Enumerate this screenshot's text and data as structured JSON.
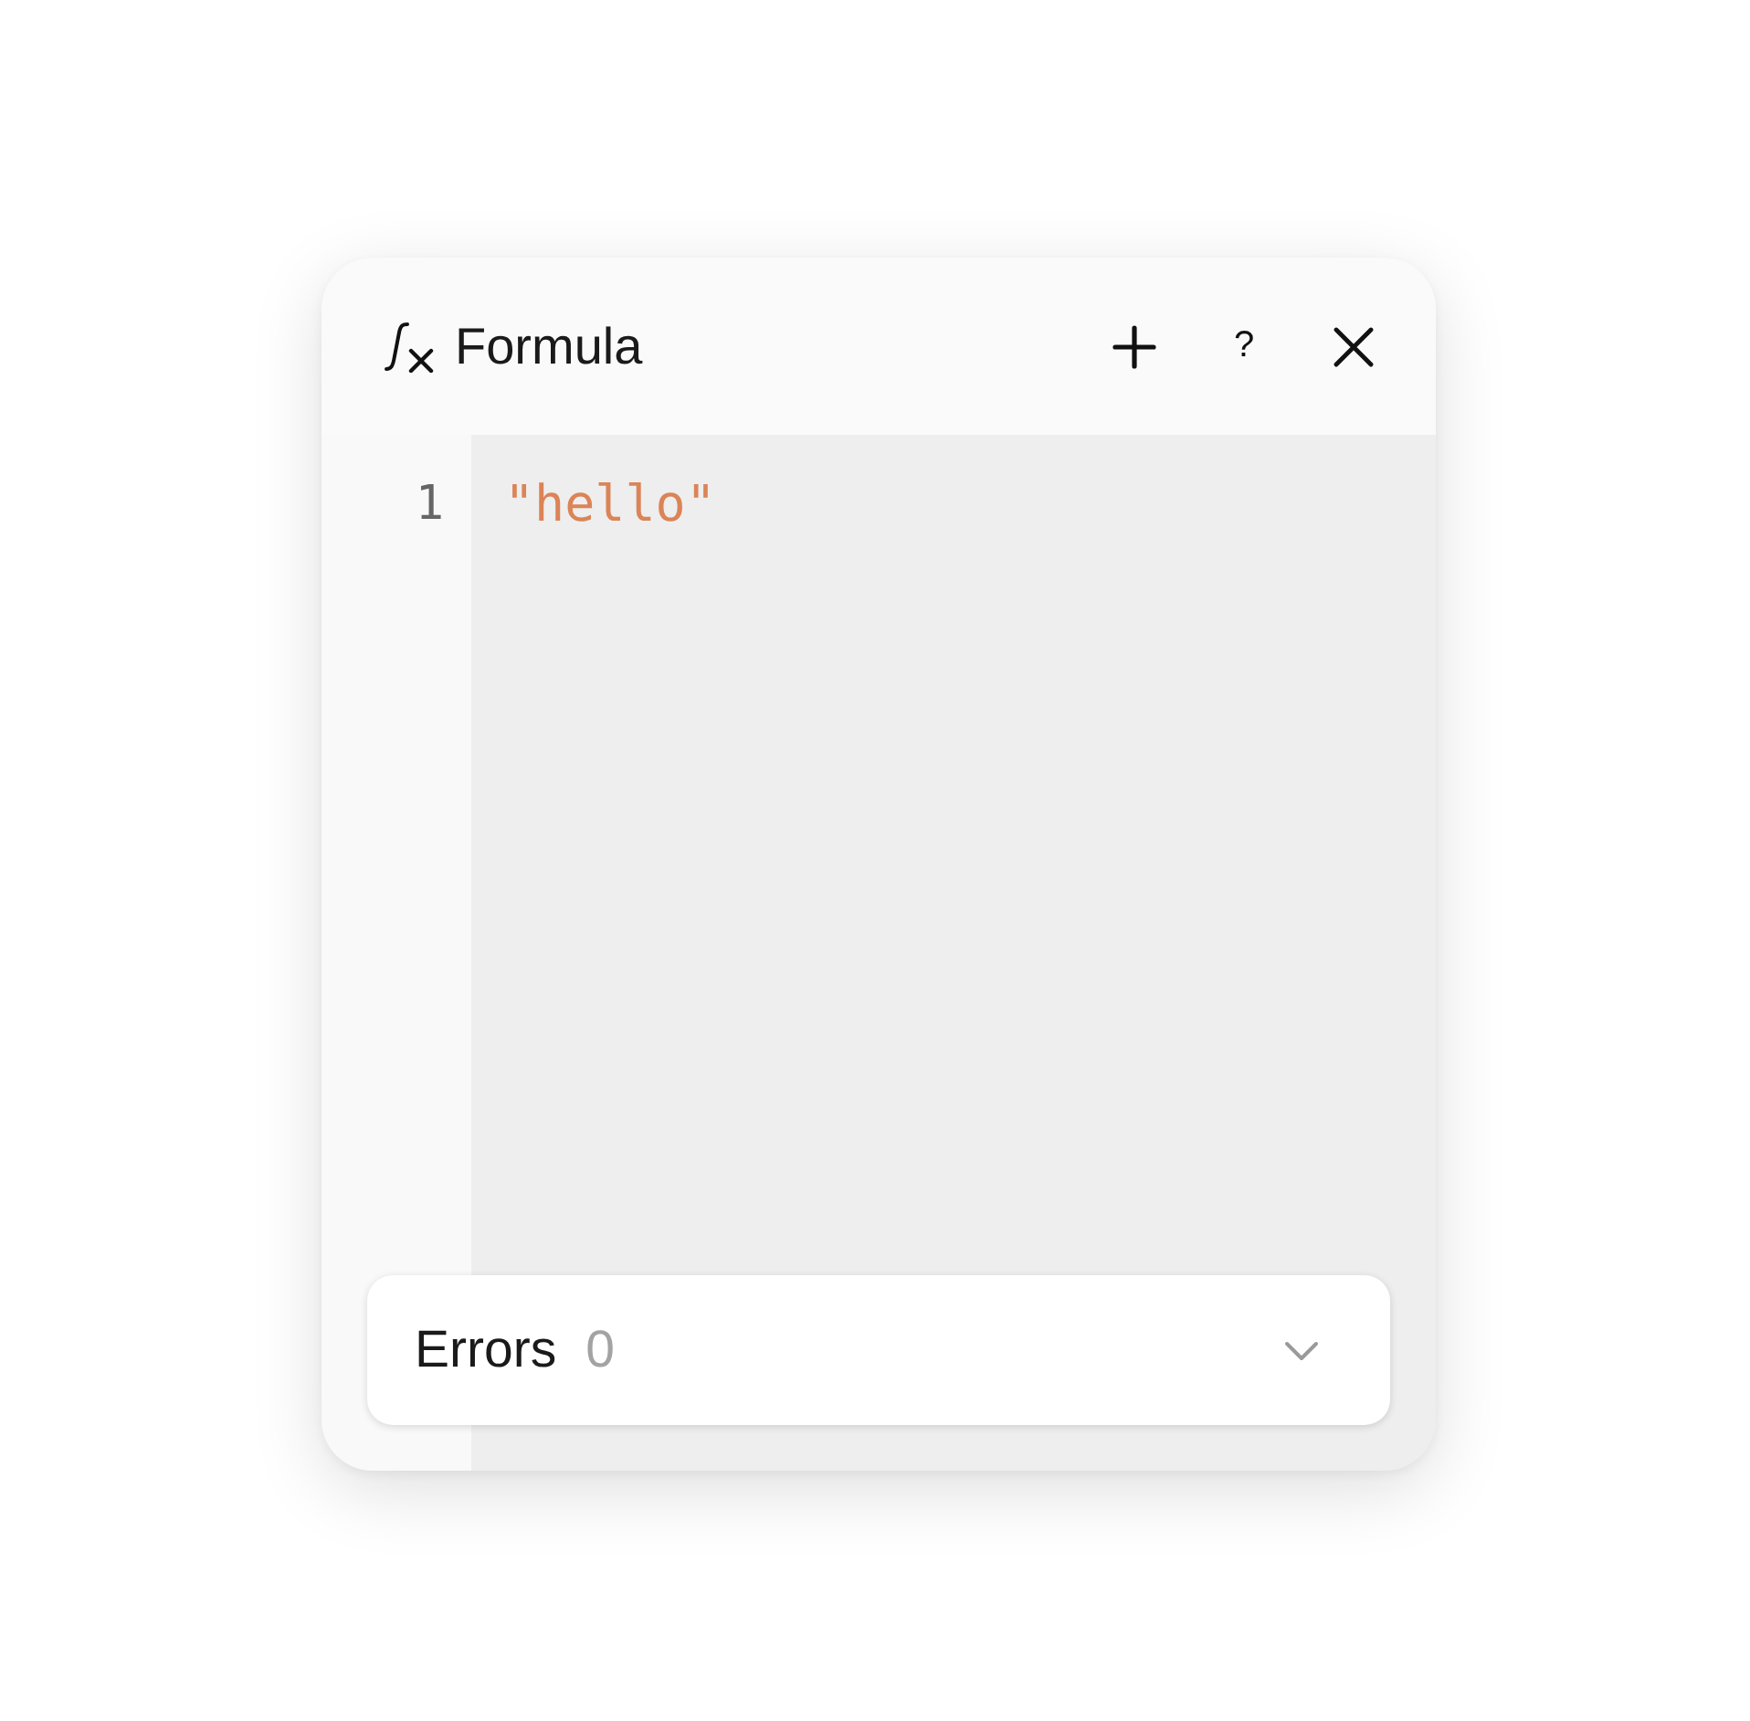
{
  "panel": {
    "title": "Formula",
    "help_label": "?"
  },
  "editor": {
    "lines": [
      {
        "number": "1",
        "tokens": [
          {
            "kind": "string",
            "text": "\"hello\""
          }
        ]
      }
    ]
  },
  "errors": {
    "label": "Errors",
    "count": "0",
    "expanded": false
  }
}
